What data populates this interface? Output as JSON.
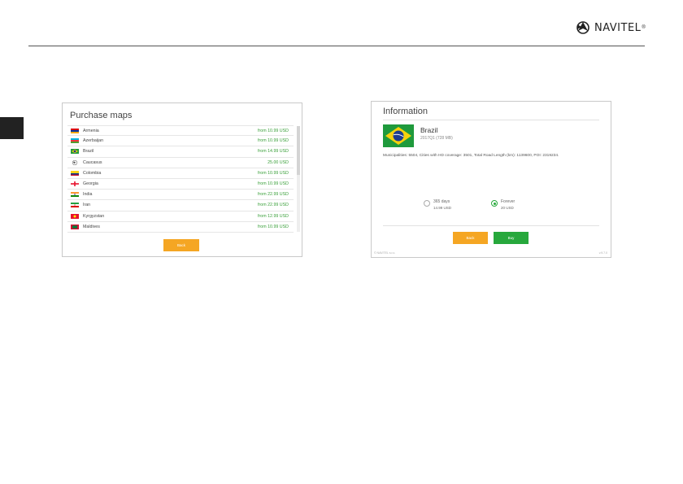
{
  "brand": {
    "name": "NAVITEL",
    "reg": "®"
  },
  "purchase": {
    "title": "Purchase maps",
    "back_label": "Back",
    "items": [
      {
        "name": "Armenia",
        "price": "from 10.99 USD",
        "flag": "armenia"
      },
      {
        "name": "Azerbaijan",
        "price": "from 10.99 USD",
        "flag": "azerbaijan"
      },
      {
        "name": "Brazil",
        "price": "from 14.99 USD",
        "flag": "brazil"
      },
      {
        "name": "Caucasus",
        "price": "25.00 USD",
        "flag": "globe"
      },
      {
        "name": "Colombia",
        "price": "from 10.99 USD",
        "flag": "colombia"
      },
      {
        "name": "Georgia",
        "price": "from 10.99 USD",
        "flag": "georgia"
      },
      {
        "name": "India",
        "price": "from 22.99 USD",
        "flag": "india"
      },
      {
        "name": "Iran",
        "price": "from 22.99 USD",
        "flag": "iran"
      },
      {
        "name": "Kyrgyzstan",
        "price": "from 12.99 USD",
        "flag": "kyrgyzstan"
      },
      {
        "name": "Maldives",
        "price": "from 10.99 USD",
        "flag": "maldives"
      }
    ]
  },
  "information": {
    "title": "Information",
    "country": "Brazil",
    "version": "2017Q1 (728 MB)",
    "details": "Municipalities: 5504, Cities with HD coverage: 3501, Total Road Length (km): 1139600, POI: 2319234.",
    "options": [
      {
        "label": "365 days",
        "price": "14.99 USD",
        "selected": false
      },
      {
        "label": "Forever",
        "price": "20 USD",
        "selected": true
      }
    ],
    "back_label": "Back",
    "buy_label": "Buy",
    "footer_left": "© NAVITEL s.r.o.",
    "footer_right": "v.9.7.0"
  }
}
